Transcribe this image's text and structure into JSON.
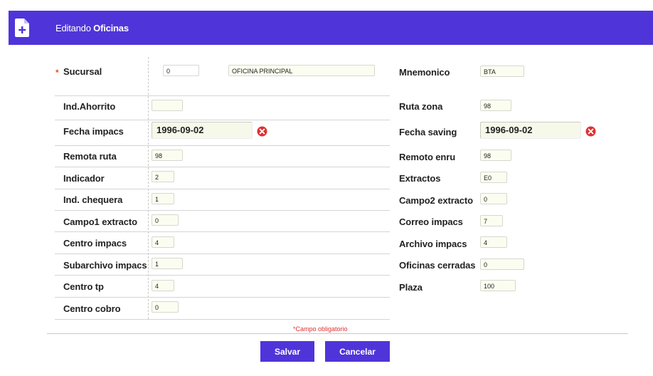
{
  "header": {
    "prefix": "Editando",
    "entity": "Oficinas",
    "icon": "file-add-icon"
  },
  "required_star": "*",
  "sucursal": {
    "label": "Sucursal",
    "code": "0",
    "name": "OFICINA PRINCIPAL"
  },
  "left_fields": [
    {
      "label": "Ind.Ahorrito",
      "value": ""
    },
    {
      "label": "Fecha impacs",
      "value": "1996-09-02"
    },
    {
      "label": "Remota ruta",
      "value": "98"
    },
    {
      "label": "Indicador",
      "value": "2"
    },
    {
      "label": "Ind. chequera",
      "value": "1"
    },
    {
      "label": "Campo1 extracto",
      "value": "0"
    },
    {
      "label": "Centro impacs",
      "value": "4"
    },
    {
      "label": "Subarchivo impacs",
      "value": "1"
    },
    {
      "label": "Centro tp",
      "value": "4"
    },
    {
      "label": "Centro cobro",
      "value": "0"
    }
  ],
  "right_fields": [
    {
      "label": "Mnemonico",
      "value": "BTA"
    },
    {
      "label": "Ruta zona",
      "value": "98"
    },
    {
      "label": "Fecha saving",
      "value": "1996-09-02"
    },
    {
      "label": "Remoto enru",
      "value": "98"
    },
    {
      "label": "Extractos",
      "value": "E0"
    },
    {
      "label": "Campo2 extracto",
      "value": "0"
    },
    {
      "label": "Correo impacs",
      "value": "7"
    },
    {
      "label": "Archivo impacs",
      "value": "4"
    },
    {
      "label": "Oficinas cerradas",
      "value": "0"
    },
    {
      "label": "Plaza",
      "value": "100"
    }
  ],
  "required_note": "*Campo obligatorio",
  "buttons": {
    "save": "Salvar",
    "cancel": "Cancelar"
  },
  "colors": {
    "accent": "#4f35d9",
    "clear": "#e03030",
    "required": "#e0542a"
  }
}
